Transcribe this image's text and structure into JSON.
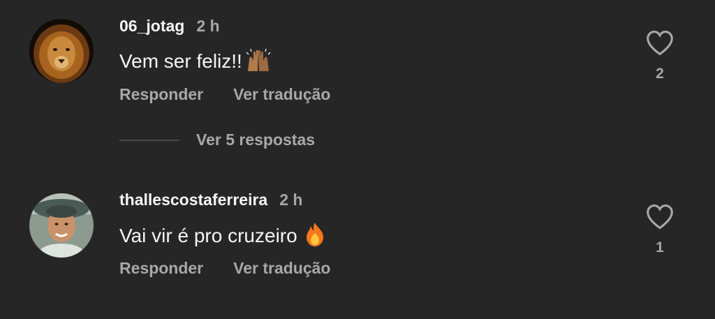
{
  "comments": [
    {
      "username": "06_jotag",
      "time": "2 h",
      "text": "Vem ser feliz!!",
      "emoji": "raised-hands",
      "likes": "2",
      "reply_label": "Responder",
      "translate_label": "Ver tradução"
    },
    {
      "username": "thallescostaferreira",
      "time": "2 h",
      "text": "Vai vir é pro cruzeiro",
      "emoji": "fire",
      "likes": "1",
      "reply_label": "Responder",
      "translate_label": "Ver tradução"
    }
  ],
  "view_replies_label": "Ver 5 respostas",
  "colors": {
    "background": "#262626",
    "primary_text": "#f5f5f5",
    "secondary_text": "#a8a8a8"
  }
}
